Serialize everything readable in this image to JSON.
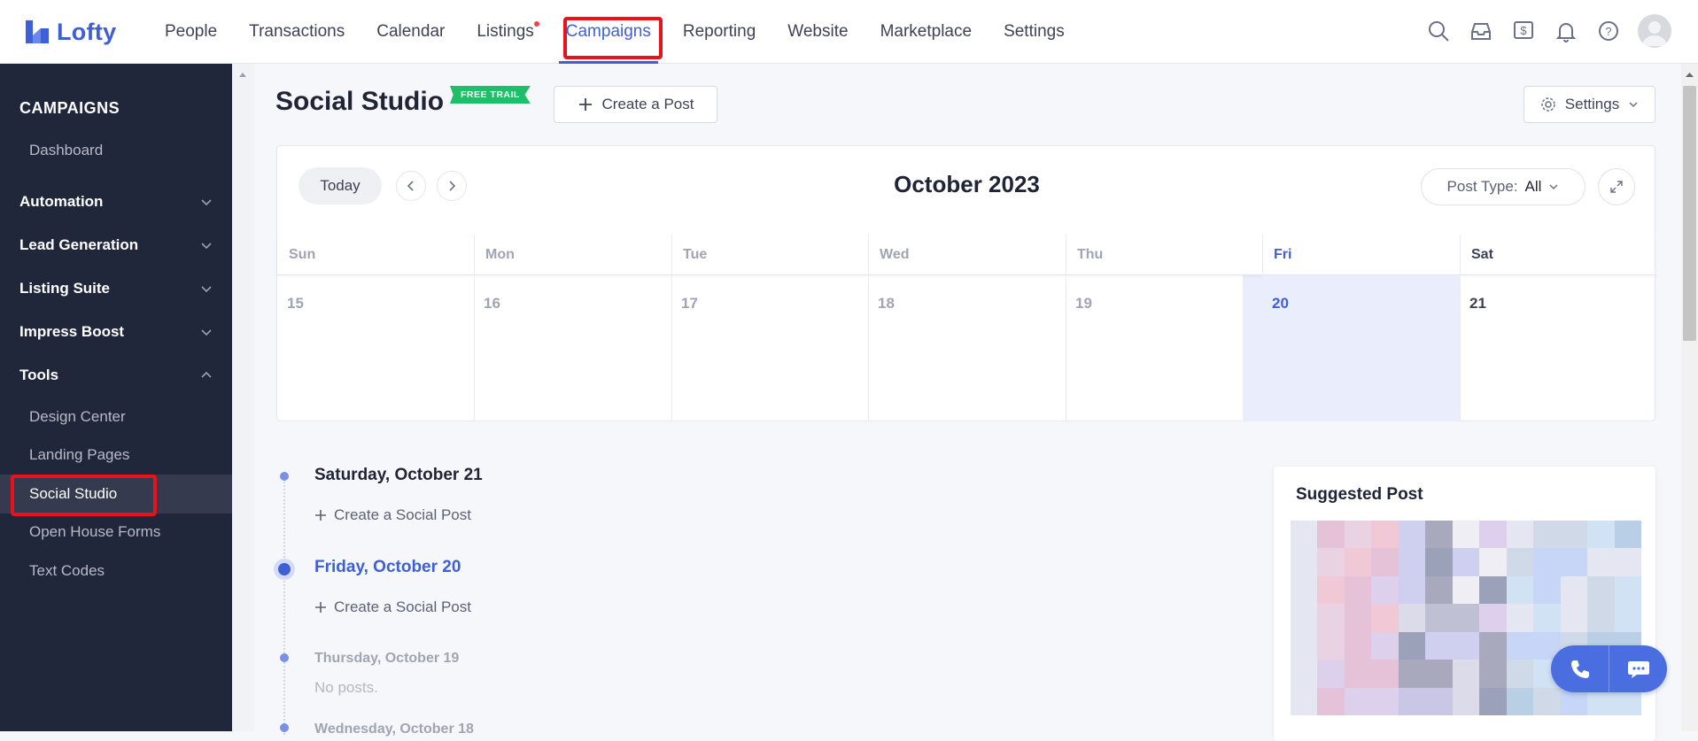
{
  "app": {
    "logo_text": "Lofty"
  },
  "nav": {
    "items": [
      {
        "label": "People"
      },
      {
        "label": "Transactions"
      },
      {
        "label": "Calendar"
      },
      {
        "label": "Listings"
      },
      {
        "label": "Campaigns"
      },
      {
        "label": "Reporting"
      },
      {
        "label": "Website"
      },
      {
        "label": "Marketplace"
      },
      {
        "label": "Settings"
      }
    ],
    "active": "Campaigns"
  },
  "top_icons": [
    "search-icon",
    "inbox-icon",
    "dollar-icon",
    "bell-icon",
    "help-icon",
    "avatar"
  ],
  "sidebar": {
    "title": "CAMPAIGNS",
    "dashboard": "Dashboard",
    "groups": [
      {
        "label": "Automation"
      },
      {
        "label": "Lead Generation"
      },
      {
        "label": "Listing Suite"
      },
      {
        "label": "Impress Boost"
      },
      {
        "label": "Tools"
      }
    ],
    "tools_items": [
      {
        "label": "Design Center"
      },
      {
        "label": "Landing Pages"
      },
      {
        "label": "Social Studio"
      },
      {
        "label": "Open House Forms"
      },
      {
        "label": "Text Codes"
      }
    ],
    "active": "Social Studio"
  },
  "page": {
    "title": "Social Studio",
    "trial_badge": "FREE TRAIL",
    "create_post": "Create a Post",
    "settings": "Settings"
  },
  "calendar": {
    "today": "Today",
    "month": "October 2023",
    "post_type_label": "Post Type:",
    "post_type_value": "All",
    "days": [
      {
        "dow": "Sun",
        "date": "15"
      },
      {
        "dow": "Mon",
        "date": "16"
      },
      {
        "dow": "Tue",
        "date": "17"
      },
      {
        "dow": "Wed",
        "date": "18"
      },
      {
        "dow": "Thu",
        "date": "19"
      },
      {
        "dow": "Fri",
        "date": "20"
      },
      {
        "dow": "Sat",
        "date": "21"
      }
    ],
    "highlight_day": "Fri"
  },
  "timeline": {
    "entries": [
      {
        "date": "Saturday, October 21",
        "action": "Create a Social Post"
      },
      {
        "date": "Friday, October 20",
        "action": "Create a Social Post"
      },
      {
        "date": "Thursday, October 19",
        "empty": "No posts."
      },
      {
        "date": "Wednesday, October 18"
      }
    ]
  },
  "suggested": {
    "title": "Suggested Post"
  },
  "colors": {
    "accent": "#3f5fd6",
    "sidebar_bg": "#21273b",
    "trial_green": "#1fbf6a",
    "highlight_red": "#e8121b"
  }
}
